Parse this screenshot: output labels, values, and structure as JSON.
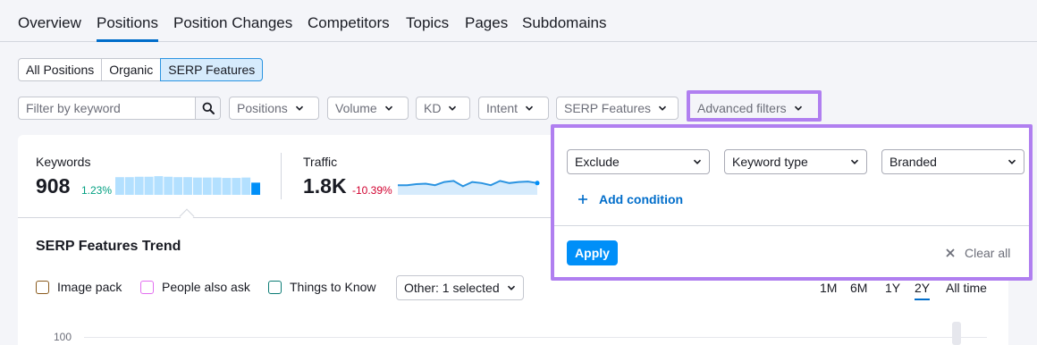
{
  "tabs": [
    "Overview",
    "Positions",
    "Position Changes",
    "Competitors",
    "Topics",
    "Pages",
    "Subdomains"
  ],
  "segments": [
    "All Positions",
    "Organic",
    "SERP Features"
  ],
  "search": {
    "placeholder": "Filter by keyword"
  },
  "filters": {
    "positions": "Positions",
    "volume": "Volume",
    "kd": "KD",
    "intent": "Intent",
    "serp_features": "SERP Features",
    "advanced": "Advanced filters"
  },
  "metrics": {
    "keywords": {
      "label": "Keywords",
      "value": "908",
      "delta": "1.23%"
    },
    "traffic": {
      "label": "Traffic",
      "value": "1.8K",
      "delta": "-10.39%"
    }
  },
  "keywords_bars": [
    0.9,
    0.9,
    0.92,
    0.92,
    0.95,
    0.92,
    0.9,
    0.9,
    0.88,
    0.88,
    0.88,
    0.86,
    0.86,
    0.88,
    0.62
  ],
  "traffic_line": [
    0.55,
    0.55,
    0.5,
    0.48,
    0.55,
    0.4,
    0.35,
    0.6,
    0.4,
    0.45,
    0.55,
    0.35,
    0.45,
    0.4,
    0.38,
    0.45
  ],
  "trend": {
    "title": "SERP Features Trend",
    "legend": [
      {
        "label": "Image pack",
        "color": "#8a5a1c"
      },
      {
        "label": "People also ask",
        "color": "#e36ff0"
      },
      {
        "label": "Things to Know",
        "color": "#0b7c75"
      }
    ],
    "other_select": "Other: 1 selected",
    "periods": [
      "1M",
      "6M",
      "1Y",
      "2Y",
      "All time"
    ],
    "active_period": "2Y",
    "y_tick": "100"
  },
  "advanced_popup": {
    "mode": "Exclude",
    "field": "Keyword type",
    "value": "Branded",
    "add_condition": "Add condition",
    "apply": "Apply",
    "clear": "Clear all"
  },
  "colors": {
    "accent": "#006dca",
    "highlight": "#b07ff0",
    "positive": "#009f81",
    "negative": "#d1002f",
    "bar": "#b3e0ff",
    "bar_last": "#008ff8"
  }
}
